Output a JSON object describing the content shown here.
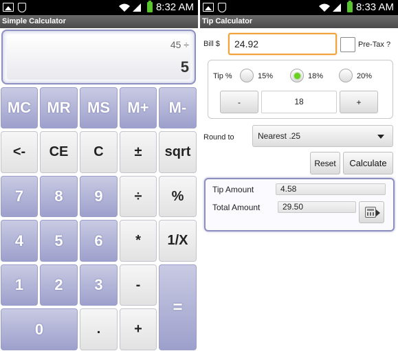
{
  "left_screen": {
    "status_time": "8:32 AM",
    "title": "Simple Calculator",
    "display": {
      "expression": "45 ÷",
      "result": "5"
    },
    "keys": {
      "mc": "MC",
      "mr": "MR",
      "ms": "MS",
      "mplus": "M+",
      "mminus": "M-",
      "back": "<-",
      "ce": "CE",
      "c": "C",
      "sign": "±",
      "sqrt": "sqrt",
      "k7": "7",
      "k8": "8",
      "k9": "9",
      "div": "÷",
      "pct": "%",
      "k4": "4",
      "k5": "5",
      "k6": "6",
      "mul": "*",
      "inv": "1/X",
      "k1": "1",
      "k2": "2",
      "k3": "3",
      "sub": "-",
      "eq": "=",
      "k0": "0",
      "dot": ".",
      "add": "+"
    }
  },
  "right_screen": {
    "status_time": "8:33 AM",
    "title": "Tip Calculator",
    "bill_label": "Bill $",
    "bill_value": "24.92",
    "pretax_label": "Pre-Tax ?",
    "pretax_checked": false,
    "tip_label": "Tip %",
    "tip_options": [
      "15%",
      "18%",
      "20%"
    ],
    "tip_selected": "18%",
    "minus_label": "-",
    "plus_label": "+",
    "tip_value": "18",
    "round_label": "Round to",
    "round_selected": "Nearest .25",
    "reset_label": "Reset",
    "calculate_label": "Calculate",
    "tip_amount_label": "Tip Amount",
    "tip_amount_value": "4.58",
    "total_amount_label": "Total Amount",
    "total_amount_value": "29.50"
  },
  "colors": {
    "calc_key_blue": "#9da0cc",
    "calc_key_gray": "#e2e2e2",
    "bill_focus": "#f2a23a",
    "radio_selected": "#6bd01e",
    "panel_border": "#8c8fbf"
  }
}
